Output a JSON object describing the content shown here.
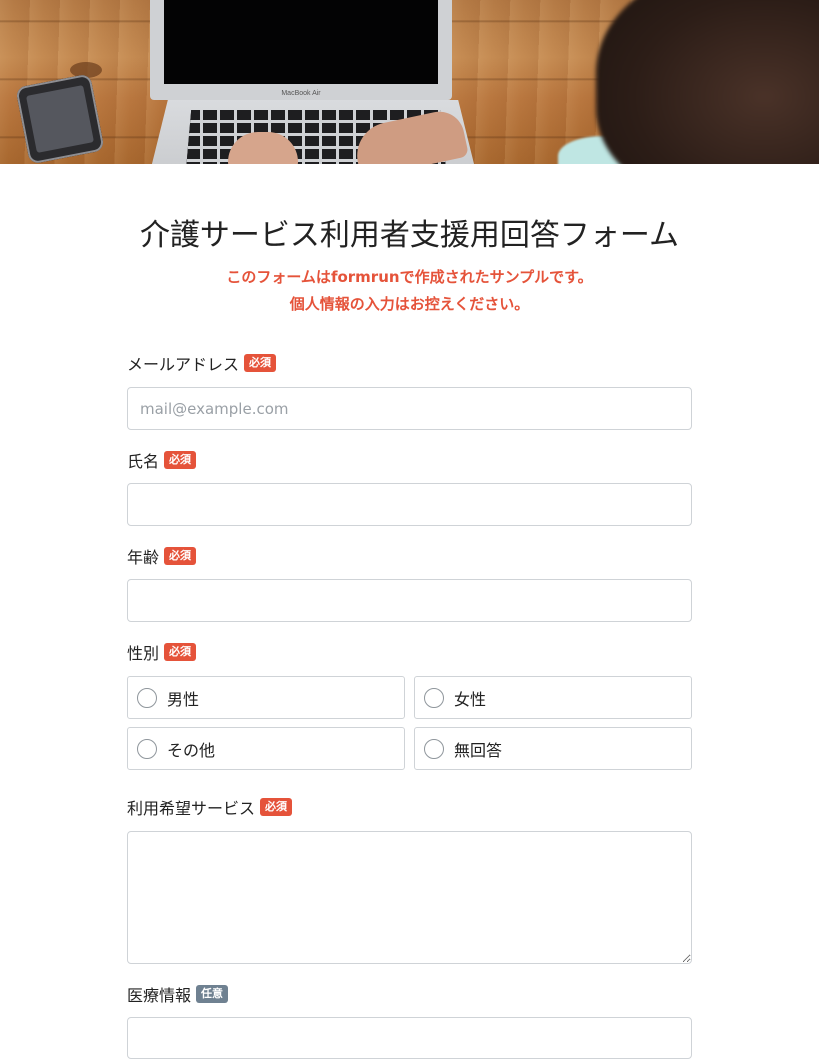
{
  "form": {
    "title": "介護サービス利用者支援用回答フォーム",
    "notice_prefix": "このフォームは",
    "notice_brand": "formrun",
    "notice_suffix": "で作成されたサンプルです。",
    "notice_line2": "個人情報の入力はお控えください。"
  },
  "hero": {
    "laptop_brand": "MacBook Air"
  },
  "badges": {
    "required": "必須",
    "optional": "任意"
  },
  "fields": {
    "email": {
      "label": "メールアドレス",
      "placeholder": "mail@example.com",
      "value": ""
    },
    "name": {
      "label": "氏名",
      "value": ""
    },
    "age": {
      "label": "年齢",
      "value": ""
    },
    "gender": {
      "label": "性別",
      "options": [
        "男性",
        "女性",
        "その他",
        "無回答"
      ],
      "selected": null
    },
    "service": {
      "label": "利用希望サービス",
      "value": ""
    },
    "medical": {
      "label": "医療情報"
    }
  },
  "colors": {
    "accent_red": "#e5533a",
    "badge_optional": "#6f8191",
    "border": "#cfd3d7"
  }
}
